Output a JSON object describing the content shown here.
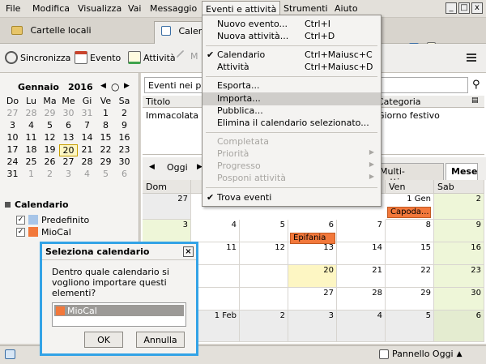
{
  "menubar": {
    "items": [
      "File",
      "Modifica",
      "Visualizza",
      "Vai",
      "Messaggio",
      "Eventi e attività",
      "Strumenti",
      "Aiuto"
    ],
    "active_index": 5
  },
  "window_controls": [
    "_",
    "□",
    "x"
  ],
  "tabs": [
    {
      "label": "Cartelle locali"
    },
    {
      "label": "Calendario"
    }
  ],
  "toolbar": {
    "sync_label": "Sincronizza",
    "event_label": "Evento",
    "task_label": "Attività",
    "edit_label": "M"
  },
  "minimonth": {
    "month": "Gennaio",
    "year": "2016",
    "weekdays": [
      "Do",
      "Lu",
      "Ma",
      "Me",
      "Gi",
      "Ve",
      "Sa"
    ],
    "weeks": [
      [
        "27",
        "28",
        "29",
        "30",
        "31",
        "1",
        "2"
      ],
      [
        "3",
        "4",
        "5",
        "6",
        "7",
        "8",
        "9"
      ],
      [
        "10",
        "11",
        "12",
        "13",
        "14",
        "15",
        "16"
      ],
      [
        "17",
        "18",
        "19",
        "20",
        "21",
        "22",
        "23"
      ],
      [
        "24",
        "25",
        "26",
        "27",
        "28",
        "29",
        "30"
      ],
      [
        "31",
        "1",
        "2",
        "3",
        "4",
        "5",
        "6"
      ]
    ]
  },
  "calendars": {
    "header": "Calendario",
    "items": [
      {
        "name": "Predefinito",
        "color": "#a7c5e8",
        "checked": true
      },
      {
        "name": "MioCal",
        "color": "#f2783b",
        "checked": true
      }
    ]
  },
  "search": {
    "value": "Eventi nei pro"
  },
  "eventlist": {
    "col_title": "Titolo",
    "col_category": "Categoria",
    "row_title": "Immacolata Co",
    "row_category": "Giorno festivo"
  },
  "navbar": {
    "today_label": "Oggi",
    "multiweek_label": "Multi-settimana",
    "month_label": "Mese"
  },
  "month_view": {
    "day_first": "Dom",
    "day_fri": "Ven",
    "day_sat": "Sab",
    "rows": [
      [
        "27",
        "",
        "",
        "",
        "",
        "1 Gen",
        "2"
      ],
      [
        "3",
        "4",
        "5",
        "6",
        "7",
        "8",
        "9"
      ],
      [
        "",
        "11",
        "12",
        "13",
        "14",
        "15",
        "16"
      ],
      [
        "",
        "",
        "",
        "20",
        "21",
        "22",
        "23"
      ],
      [
        "",
        "",
        "",
        "27",
        "28",
        "29",
        "30"
      ],
      [
        "",
        "1 Feb",
        "2",
        "3",
        "4",
        "5",
        "6"
      ]
    ],
    "events": [
      {
        "label": "Capoda...",
        "color": "#f2783b"
      },
      {
        "label": "Epifania",
        "color": "#f2783b"
      }
    ]
  },
  "dropdown": {
    "items": [
      {
        "label": "Nuovo evento...",
        "shortcut": "Ctrl+I"
      },
      {
        "label": "Nuova attività...",
        "shortcut": "Ctrl+D"
      },
      {
        "label": "Calendario",
        "shortcut": "Ctrl+Maiusc+C",
        "checked": true
      },
      {
        "label": "Attività",
        "shortcut": "Ctrl+Maiusc+D"
      },
      {
        "label": "Esporta..."
      },
      {
        "label": "Importa...",
        "highlighted": true
      },
      {
        "label": "Pubblica..."
      },
      {
        "label": "Elimina il calendario selezionato..."
      },
      {
        "label": "Completata",
        "disabled": true
      },
      {
        "label": "Priorità",
        "disabled": true,
        "submenu": true
      },
      {
        "label": "Progresso",
        "disabled": true,
        "submenu": true
      },
      {
        "label": "Posponi attività",
        "disabled": true,
        "submenu": true
      },
      {
        "label": "Trova eventi",
        "checked": true
      }
    ]
  },
  "dialog": {
    "title": "Seleziona calendario",
    "message": "Dentro quale calendario si vogliono importare questi elementi?",
    "selected_calendar": "MioCal",
    "selected_color": "#f2783b",
    "ok_label": "OK",
    "cancel_label": "Annulla"
  },
  "statusbar": {
    "today_pane_label": "Pannello Oggi"
  }
}
